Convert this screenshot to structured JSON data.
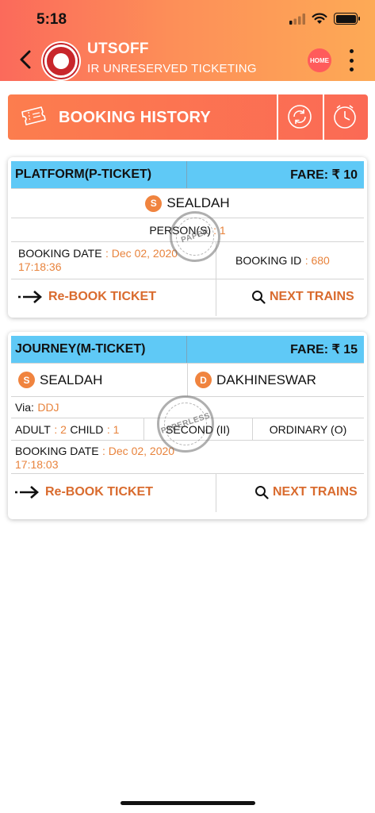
{
  "status_bar": {
    "time": "5:18"
  },
  "app": {
    "title": "UTSOFF",
    "subtitle": "IR UNRESERVED TICKETING",
    "home_label": "HOME"
  },
  "history": {
    "label": "BOOKING HISTORY"
  },
  "colors": {
    "header_start": "#fb6a5b",
    "header_end": "#fdaa56",
    "ticket_type_bg": "#5fc9f6",
    "accent": "#e8833c"
  },
  "tickets": [
    {
      "type": "PLATFORM(P-TICKET)",
      "fare": "FARE: ₹ 10",
      "station_badge": "S",
      "station": "SEALDAH",
      "persons_label": "PERSON(S)",
      "persons_value": ": 1",
      "booking_date_label": "BOOKING DATE",
      "booking_date_value": ": Dec 02, 2020",
      "booking_time": "17:18:36",
      "booking_id_label": "BOOKING ID",
      "booking_id_value": ": 680",
      "stamp_text": "PAPER",
      "rebook_label": "Re-BOOK TICKET",
      "next_trains_label": "NEXT TRAINS"
    },
    {
      "type": "JOURNEY(M-TICKET)",
      "fare": "FARE: ₹ 15",
      "source_badge": "S",
      "source": "SEALDAH",
      "dest_badge": "D",
      "dest": "DAKHINESWAR",
      "via_label": "Via:",
      "via_value": "DDJ",
      "adult_label": "ADULT",
      "adult_value": ": 2",
      "child_label": "CHILD",
      "child_value": ": 1",
      "class": "SECOND (II)",
      "train_type": "ORDINARY (O)",
      "booking_date_label": "BOOKING DATE",
      "booking_date_value": ": Dec 02, 2020",
      "booking_time": "17:18:03",
      "stamp_text": "PAPERLESS",
      "rebook_label": "Re-BOOK TICKET",
      "next_trains_label": "NEXT TRAINS"
    }
  ]
}
